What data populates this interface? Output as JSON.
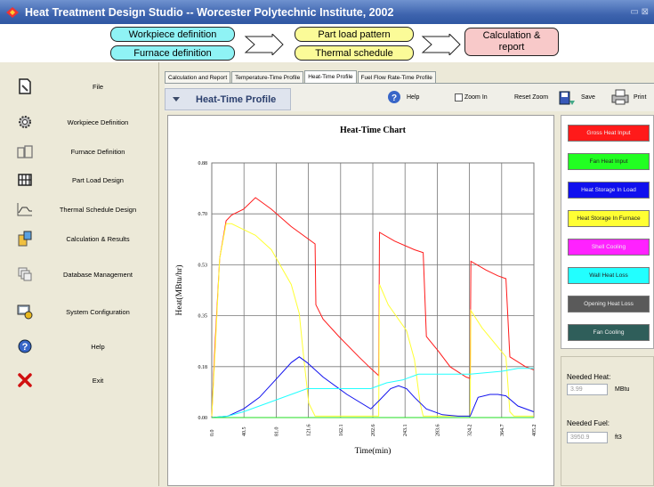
{
  "window": {
    "title": "Heat Treatment Design Studio -- Worcester Polytechnic Institute, 2002",
    "controls": "▭ ⊠"
  },
  "workflow": {
    "workpiece": "Workpiece definition",
    "furnace": "Furnace definition",
    "part_load": "Part load pattern",
    "thermal": "Thermal schedule",
    "calc_line1": "Calculation &",
    "calc_line2": "report"
  },
  "sidebar": {
    "items": [
      {
        "label": "File",
        "icon": "file-icon"
      },
      {
        "label": "Workpiece Definition",
        "icon": "gear-icon"
      },
      {
        "label": "Furnace Definition",
        "icon": "furnace-icon"
      },
      {
        "label": "Part Load Design",
        "icon": "grid-icon"
      },
      {
        "label": "Thermal Schedule Design",
        "icon": "curve-icon"
      },
      {
        "label": "Calculation & Results",
        "icon": "calculator-icon"
      },
      {
        "label": "Database Management",
        "icon": "database-icon"
      },
      {
        "label": "System Configuration",
        "icon": "config-icon"
      },
      {
        "label": "Help",
        "icon": "help-icon"
      },
      {
        "label": "Exit",
        "icon": "exit-icon"
      }
    ]
  },
  "tabs": [
    "Calculation and Report",
    "Temperature-Time Profile",
    "Heat-Time Profile",
    "Fuel Flow Rate-Time Profile"
  ],
  "active_tab": "Heat-Time Profile",
  "panel_title": "Heat-Time Profile",
  "toolbar": {
    "help": "Help",
    "zoom_in": "Zoom In",
    "reset_zoom": "Reset Zoom",
    "save": "Save",
    "print": "Print"
  },
  "legend": [
    {
      "label": "Gross Heat Input",
      "color": "#ff1a1a"
    },
    {
      "label": "Fan Heat Input",
      "color": "#22ff22"
    },
    {
      "label": "Heat Storage In Load",
      "color": "#1010ee"
    },
    {
      "label": "Heat Storage In Furnace",
      "color": "#ffff33"
    },
    {
      "label": "Shell Cooling",
      "color": "#ff22ff"
    },
    {
      "label": "Wall Heat Loss",
      "color": "#22ffff"
    },
    {
      "label": "Opening Heat Loss",
      "color": "#5a5a5a"
    },
    {
      "label": "Fan Cooling",
      "color": "#2f5e5a"
    }
  ],
  "needed": {
    "heat_label": "Needed Heat:",
    "heat_value": "3.99",
    "heat_unit": "MBtu",
    "fuel_label": "Needed Fuel:",
    "fuel_value": "3950.9",
    "fuel_unit": "ft3"
  },
  "chart_data": {
    "type": "line",
    "title": "Heat-Time Chart",
    "xlabel": "Time(min)",
    "ylabel": "Heat(MBtu/hr)",
    "xlim": [
      0,
      405.2
    ],
    "ylim": [
      0,
      0.88
    ],
    "xticks": [
      "0.0",
      "40.5",
      "81.0",
      "121.6",
      "162.1",
      "202.6",
      "243.1",
      "283.6",
      "324.2",
      "364.7",
      "405.2"
    ],
    "yticks": [
      "0.00",
      "0.18",
      "0.35",
      "0.53",
      "0.70",
      "0.88"
    ],
    "grid": true,
    "series": [
      {
        "name": "Gross Heat Input",
        "color": "#ff1a1a",
        "x": [
          0,
          4,
          10,
          18,
          25,
          40,
          55,
          65,
          75,
          100,
          130,
          131,
          140,
          160,
          185,
          200,
          210,
          211,
          230,
          255,
          266,
          270,
          285,
          300,
          320,
          325,
          326,
          345,
          360,
          370,
          375,
          395,
          405
        ],
        "y": [
          0.005,
          0.25,
          0.55,
          0.68,
          0.7,
          0.72,
          0.76,
          0.74,
          0.72,
          0.66,
          0.6,
          0.39,
          0.34,
          0.28,
          0.21,
          0.17,
          0.145,
          0.64,
          0.61,
          0.58,
          0.57,
          0.28,
          0.23,
          0.175,
          0.14,
          0.135,
          0.54,
          0.51,
          0.49,
          0.48,
          0.21,
          0.175,
          0.165
        ]
      },
      {
        "name": "Heat Storage In Furnace",
        "color": "#ffff33",
        "x": [
          0,
          4,
          10,
          18,
          25,
          40,
          55,
          75,
          100,
          110,
          116,
          122,
          130,
          205,
          210,
          211,
          222,
          245,
          255,
          262,
          266,
          270,
          275,
          320,
          325,
          326,
          340,
          370,
          375,
          380,
          405
        ],
        "y": [
          0.005,
          0.22,
          0.55,
          0.67,
          0.67,
          0.65,
          0.63,
          0.58,
          0.46,
          0.36,
          0.2,
          0.05,
          0.005,
          0.005,
          0.005,
          0.46,
          0.39,
          0.3,
          0.2,
          0.05,
          0.005,
          0.005,
          0.005,
          0.005,
          0.005,
          0.37,
          0.31,
          0.21,
          0.02,
          0.005,
          0.005
        ]
      },
      {
        "name": "Heat Storage In Load",
        "color": "#1010ee",
        "x": [
          0,
          20,
          40,
          60,
          80,
          100,
          110,
          120,
          140,
          170,
          200,
          211,
          225,
          235,
          245,
          255,
          270,
          290,
          310,
          325,
          335,
          350,
          360,
          370,
          385,
          405
        ],
        "y": [
          0.0,
          0.005,
          0.03,
          0.07,
          0.13,
          0.19,
          0.21,
          0.19,
          0.14,
          0.08,
          0.03,
          0.06,
          0.1,
          0.11,
          0.1,
          0.07,
          0.03,
          0.01,
          0.005,
          0.005,
          0.07,
          0.08,
          0.08,
          0.075,
          0.04,
          0.02
        ]
      },
      {
        "name": "Wall Heat Loss",
        "color": "#22ffff",
        "x": [
          0,
          20,
          40,
          60,
          80,
          100,
          120,
          160,
          200,
          220,
          240,
          260,
          300,
          325,
          345,
          365,
          385,
          405
        ],
        "y": [
          0.0,
          0.005,
          0.02,
          0.04,
          0.06,
          0.08,
          0.1,
          0.1,
          0.1,
          0.12,
          0.13,
          0.15,
          0.15,
          0.15,
          0.155,
          0.16,
          0.17,
          0.17
        ]
      },
      {
        "name": "Fan Heat Input",
        "color": "#22dd22",
        "x": [
          0,
          100,
          200,
          300,
          405
        ],
        "y": [
          0.0,
          0.0,
          0.0,
          0.0,
          0.0
        ]
      }
    ]
  }
}
